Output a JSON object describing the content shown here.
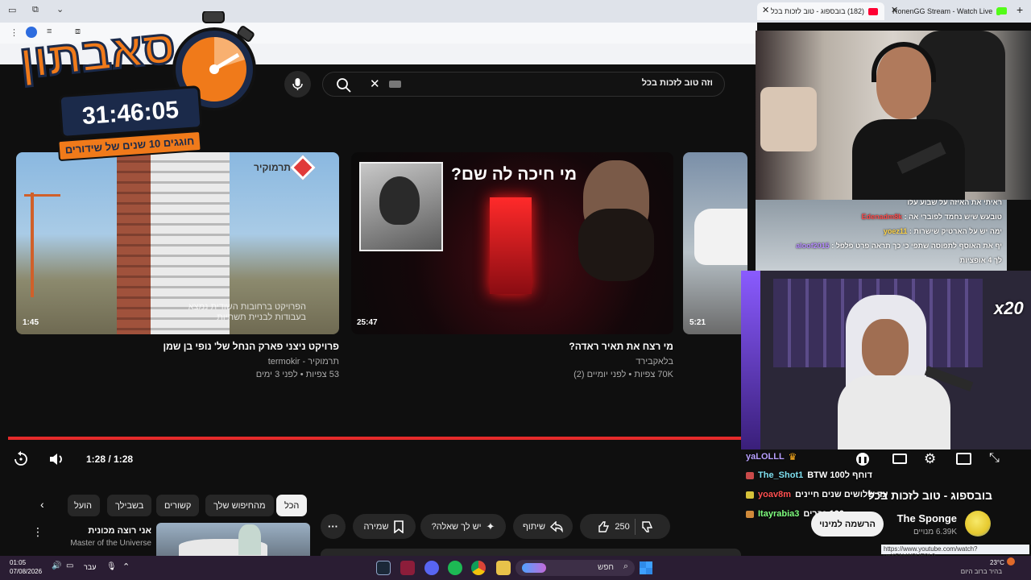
{
  "browser": {
    "tabs": [
      {
        "label": "RonenGG Stream - Watch Live",
        "badge": ""
      },
      {
        "label": "(182) בובספוג - טוב לזכות בכל",
        "badge": "182"
      },
      {
        "label": "לזכות ב:",
        "badge": ""
      }
    ]
  },
  "logo": {
    "title": "סאבתון",
    "timer": "31:46:05",
    "subtitle": "חוגגים 10 שנים של שידורים"
  },
  "search": {
    "query": "וזה טוב לזכות בכל"
  },
  "videos": [
    {
      "title": "פרויקט ניצני פארק הנחל של' נופי בן שמן",
      "channel": "תרמוקיר - termokir",
      "meta": "53 צפיות • לפני 3 ימים",
      "duration": "1:45",
      "brand": "תרמוקיר",
      "overlay": "הפרויקט ברחובות השודית נמצא בעבודות לבניית תשתיות"
    },
    {
      "title": "מי רצח את תאיר ראדה?",
      "channel": "בלאקבירד",
      "meta": "70K צפיות • לפני יומיים (2)",
      "duration": "25:47",
      "headline": "מי חיכה לה שם?"
    },
    {
      "title": "",
      "duration": "5:21"
    }
  ],
  "player": {
    "time": "1:28 / 1:28"
  },
  "chips": [
    "הכל",
    "מהחיפוש שלך",
    "קשורים",
    "בשבילך",
    "הועל"
  ],
  "actions": {
    "likes": "250",
    "share": "שיתוף",
    "ask": "יש לך שאלה?",
    "save": "שמירה"
  },
  "related": {
    "title": "אני רוצה מכונית",
    "channel": "Master of the Universe"
  },
  "stream_chat_top": [
    {
      "user": "",
      "text": "ראיתי את האיזה על שבוע עלו"
    },
    {
      "user": "Edenadm8k",
      "text": "טובעש שיש נחמד לפוברי אה"
    },
    {
      "user": "yoez11",
      "text": "ימה יש על הארטיק שישרות"
    },
    {
      "user": "aloof2015",
      "text": "יף את האוסף לתפוסה שתפי כי כך תראה פרט פלפל"
    },
    {
      "user": "",
      "text": "לך 4 אופציות"
    }
  ],
  "stream": {
    "multiplier": "x20",
    "video_title": "בובספוג - טוב לזכות בכל",
    "channel": "The Sponge",
    "subs": "6.39K מנויים",
    "subscribe": "הרשמה למינוי",
    "tooltip": "https://www.youtube.com/watch?v=XSNrW9UE0L0"
  },
  "stream_chat": [
    {
      "user": "yaLOLLL",
      "text": "",
      "color": "#b8a0ff"
    },
    {
      "user": "The_Shot1",
      "text": "דוחף ל100 BTW",
      "color": "#7fe0f0"
    },
    {
      "user": "yoav8m",
      "text": "עד שלושים שנים חיינים",
      "color": "#ff5050"
    },
    {
      "user": "Itayrabia3",
      "text": "100 נברים",
      "color": "#7fff7f"
    }
  ],
  "taskbar": {
    "search": "חפש",
    "time": "01:05",
    "date": "07/08/2026",
    "lang": "עבר",
    "temp": "23°C",
    "weather": "בהיר ברוב היום"
  },
  "colors": {
    "youtube_red": "#e52a2a",
    "logo_orange": "#f07a1a",
    "logo_navy": "#1b2a4a"
  }
}
